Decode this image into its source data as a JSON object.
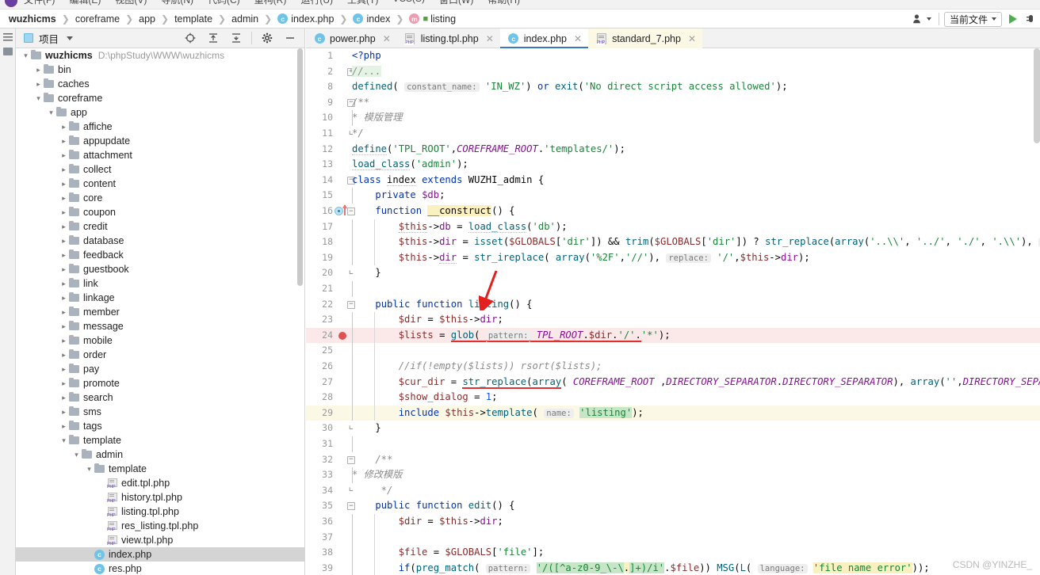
{
  "menu": {
    "items": [
      "文件(F)",
      "编辑(E)",
      "视图(V)",
      "导航(N)",
      "代码(C)",
      "重构(R)",
      "运行(U)",
      "工具(T)",
      "VCS(S)",
      "窗口(W)",
      "帮助(H)"
    ]
  },
  "breadcrumb": {
    "items": [
      {
        "label": "wuzhicms",
        "icon": "",
        "bold": true
      },
      {
        "label": "coreframe",
        "icon": "",
        "bold": false
      },
      {
        "label": "app",
        "icon": "",
        "bold": false
      },
      {
        "label": "template",
        "icon": "",
        "bold": false
      },
      {
        "label": "admin",
        "icon": "",
        "bold": false
      },
      {
        "label": "index.php",
        "icon": "class-c-icon",
        "bold": false
      },
      {
        "label": "index",
        "icon": "class-c-icon",
        "bold": false
      },
      {
        "label": "listing",
        "icon": "method-m-icon",
        "bold": false
      }
    ],
    "right": {
      "user_icon": "user-icon",
      "run_config": "当前文件",
      "run_icon": "run-play-icon"
    }
  },
  "left_rail": {
    "tab_label": "项目"
  },
  "project_panel": {
    "title": "项目",
    "tools": [
      "locate-target-icon",
      "collapse-to-top-icon",
      "collapse-all-icon",
      "settings-gear-icon",
      "minimize-icon"
    ]
  },
  "tabs": [
    {
      "label": "power.php",
      "icon": "class-c-icon",
      "state": "normal"
    },
    {
      "label": "listing.tpl.php",
      "icon": "php-file-icon",
      "state": "normal"
    },
    {
      "label": "index.php",
      "icon": "class-c-icon",
      "state": "active"
    },
    {
      "label": "standard_7.php",
      "icon": "php-file-icon",
      "state": "modified"
    }
  ],
  "tree": [
    {
      "depth": 0,
      "arrow": "expanded",
      "icon": "folder",
      "label": "wuzhicms",
      "bold": true,
      "path": "D:\\phpStudy\\WWW\\wuzhicms",
      "selected": false
    },
    {
      "depth": 1,
      "arrow": "collapsed",
      "icon": "folder",
      "label": "bin",
      "bold": false,
      "path": "",
      "selected": false
    },
    {
      "depth": 1,
      "arrow": "collapsed",
      "icon": "folder",
      "label": "caches",
      "bold": false,
      "path": "",
      "selected": false
    },
    {
      "depth": 1,
      "arrow": "expanded",
      "icon": "folder",
      "label": "coreframe",
      "bold": false,
      "path": "",
      "selected": false
    },
    {
      "depth": 2,
      "arrow": "expanded",
      "icon": "folder",
      "label": "app",
      "bold": false,
      "path": "",
      "selected": false
    },
    {
      "depth": 3,
      "arrow": "collapsed",
      "icon": "folder",
      "label": "affiche",
      "bold": false,
      "path": "",
      "selected": false
    },
    {
      "depth": 3,
      "arrow": "collapsed",
      "icon": "folder",
      "label": "appupdate",
      "bold": false,
      "path": "",
      "selected": false
    },
    {
      "depth": 3,
      "arrow": "collapsed",
      "icon": "folder",
      "label": "attachment",
      "bold": false,
      "path": "",
      "selected": false
    },
    {
      "depth": 3,
      "arrow": "collapsed",
      "icon": "folder",
      "label": "collect",
      "bold": false,
      "path": "",
      "selected": false
    },
    {
      "depth": 3,
      "arrow": "collapsed",
      "icon": "folder",
      "label": "content",
      "bold": false,
      "path": "",
      "selected": false
    },
    {
      "depth": 3,
      "arrow": "collapsed",
      "icon": "folder",
      "label": "core",
      "bold": false,
      "path": "",
      "selected": false
    },
    {
      "depth": 3,
      "arrow": "collapsed",
      "icon": "folder",
      "label": "coupon",
      "bold": false,
      "path": "",
      "selected": false
    },
    {
      "depth": 3,
      "arrow": "collapsed",
      "icon": "folder",
      "label": "credit",
      "bold": false,
      "path": "",
      "selected": false
    },
    {
      "depth": 3,
      "arrow": "collapsed",
      "icon": "folder",
      "label": "database",
      "bold": false,
      "path": "",
      "selected": false
    },
    {
      "depth": 3,
      "arrow": "collapsed",
      "icon": "folder",
      "label": "feedback",
      "bold": false,
      "path": "",
      "selected": false
    },
    {
      "depth": 3,
      "arrow": "collapsed",
      "icon": "folder",
      "label": "guestbook",
      "bold": false,
      "path": "",
      "selected": false
    },
    {
      "depth": 3,
      "arrow": "collapsed",
      "icon": "folder",
      "label": "link",
      "bold": false,
      "path": "",
      "selected": false
    },
    {
      "depth": 3,
      "arrow": "collapsed",
      "icon": "folder",
      "label": "linkage",
      "bold": false,
      "path": "",
      "selected": false
    },
    {
      "depth": 3,
      "arrow": "collapsed",
      "icon": "folder",
      "label": "member",
      "bold": false,
      "path": "",
      "selected": false
    },
    {
      "depth": 3,
      "arrow": "collapsed",
      "icon": "folder",
      "label": "message",
      "bold": false,
      "path": "",
      "selected": false
    },
    {
      "depth": 3,
      "arrow": "collapsed",
      "icon": "folder",
      "label": "mobile",
      "bold": false,
      "path": "",
      "selected": false
    },
    {
      "depth": 3,
      "arrow": "collapsed",
      "icon": "folder",
      "label": "order",
      "bold": false,
      "path": "",
      "selected": false
    },
    {
      "depth": 3,
      "arrow": "collapsed",
      "icon": "folder",
      "label": "pay",
      "bold": false,
      "path": "",
      "selected": false
    },
    {
      "depth": 3,
      "arrow": "collapsed",
      "icon": "folder",
      "label": "promote",
      "bold": false,
      "path": "",
      "selected": false
    },
    {
      "depth": 3,
      "arrow": "collapsed",
      "icon": "folder",
      "label": "search",
      "bold": false,
      "path": "",
      "selected": false
    },
    {
      "depth": 3,
      "arrow": "collapsed",
      "icon": "folder",
      "label": "sms",
      "bold": false,
      "path": "",
      "selected": false
    },
    {
      "depth": 3,
      "arrow": "collapsed",
      "icon": "folder",
      "label": "tags",
      "bold": false,
      "path": "",
      "selected": false
    },
    {
      "depth": 3,
      "arrow": "expanded",
      "icon": "folder",
      "label": "template",
      "bold": false,
      "path": "",
      "selected": false
    },
    {
      "depth": 4,
      "arrow": "expanded",
      "icon": "folder",
      "label": "admin",
      "bold": false,
      "path": "",
      "selected": false
    },
    {
      "depth": 5,
      "arrow": "expanded",
      "icon": "folder",
      "label": "template",
      "bold": false,
      "path": "",
      "selected": false
    },
    {
      "depth": 6,
      "arrow": "none",
      "icon": "php",
      "label": "edit.tpl.php",
      "bold": false,
      "path": "",
      "selected": false
    },
    {
      "depth": 6,
      "arrow": "none",
      "icon": "php",
      "label": "history.tpl.php",
      "bold": false,
      "path": "",
      "selected": false
    },
    {
      "depth": 6,
      "arrow": "none",
      "icon": "php",
      "label": "listing.tpl.php",
      "bold": false,
      "path": "",
      "selected": false
    },
    {
      "depth": 6,
      "arrow": "none",
      "icon": "php",
      "label": "res_listing.tpl.php",
      "bold": false,
      "path": "",
      "selected": false
    },
    {
      "depth": 6,
      "arrow": "none",
      "icon": "php",
      "label": "view.tpl.php",
      "bold": false,
      "path": "",
      "selected": false
    },
    {
      "depth": 5,
      "arrow": "none",
      "icon": "class",
      "label": "index.php",
      "bold": false,
      "path": "",
      "selected": true
    },
    {
      "depth": 5,
      "arrow": "none",
      "icon": "class",
      "label": "res.php",
      "bold": false,
      "path": "",
      "selected": false
    }
  ],
  "code": {
    "file": "index.php",
    "lines": [
      {
        "n": 1,
        "text": "<?php"
      },
      {
        "n": 2,
        "text": "//..."
      },
      {
        "n": 8,
        "text": "defined( constant_name: 'IN_WZ') or exit('No direct script access allowed');"
      },
      {
        "n": 9,
        "text": "/**"
      },
      {
        "n": 10,
        "text": " *  模版管理"
      },
      {
        "n": 11,
        "text": " */"
      },
      {
        "n": 12,
        "text": "define('TPL_ROOT',COREFRAME_ROOT.'templates/');"
      },
      {
        "n": 13,
        "text": "load_class('admin');"
      },
      {
        "n": 14,
        "text": "class index extends WUZHI_admin {"
      },
      {
        "n": 15,
        "text": "    private $db;"
      },
      {
        "n": 16,
        "text": "    function __construct() {"
      },
      {
        "n": 17,
        "text": "        $this->db = load_class('db');"
      },
      {
        "n": 18,
        "text": "        $this->dir = isset($GLOBALS['dir']) && trim($GLOBALS['dir']) ? str_replace(array('..\\\\', '../', './', '.\\\\'), re"
      },
      {
        "n": 19,
        "text": "        $this->dir = str_ireplace( array('%2F','//'), replace: '/',$this->dir);"
      },
      {
        "n": 20,
        "text": "    }"
      },
      {
        "n": 21,
        "text": ""
      },
      {
        "n": 22,
        "text": "    public function listing() {"
      },
      {
        "n": 23,
        "text": "        $dir = $this->dir;"
      },
      {
        "n": 24,
        "text": "        $lists = glob( pattern: TPL_ROOT.$dir.'/'.'*');"
      },
      {
        "n": 25,
        "text": ""
      },
      {
        "n": 26,
        "text": "        //if(!empty($lists)) rsort($lists);"
      },
      {
        "n": 27,
        "text": "        $cur_dir = str_replace(array( COREFRAME_ROOT ,DIRECTORY_SEPARATOR.DIRECTORY_SEPARATOR), array('',DIRECTORY_SEPAR"
      },
      {
        "n": 28,
        "text": "        $show_dialog = 1;"
      },
      {
        "n": 29,
        "text": "        include $this->template( name: 'listing');"
      },
      {
        "n": 30,
        "text": "    }"
      },
      {
        "n": 31,
        "text": ""
      },
      {
        "n": 32,
        "text": "    /**"
      },
      {
        "n": 33,
        "text": "     * 修改模版"
      },
      {
        "n": 34,
        "text": "     */"
      },
      {
        "n": 35,
        "text": "    public function edit() {"
      },
      {
        "n": 36,
        "text": "        $dir = $this->dir;"
      },
      {
        "n": 37,
        "text": ""
      },
      {
        "n": 38,
        "text": "        $file = $GLOBALS['file'];"
      },
      {
        "n": 39,
        "text": "        if(preg_match( pattern: '/([^a-z0-9_\\-\\.]+)/i'.$file)) MSG(L( language: 'file name error'));"
      }
    ],
    "breakpoint_line": 24,
    "highlight_pink_line": 24,
    "highlight_yellow_line": 29
  },
  "annotations": {
    "arrow_color": "#e32020",
    "underline_color": "#e03030",
    "underlined_tokens": [
      "glob",
      "str_replace"
    ]
  },
  "watermark": "CSDN @YINZHE_",
  "colors": {
    "accent_tab_underline": "#3c77c2",
    "keyword": "#0033b3",
    "string": "#1a8439",
    "variable": "#871094",
    "dollar_var": "#8a2b2b",
    "function": "#00627a",
    "comment": "#8c8c8c",
    "breakpoint": "#e05252",
    "run_green": "#4caf50"
  }
}
